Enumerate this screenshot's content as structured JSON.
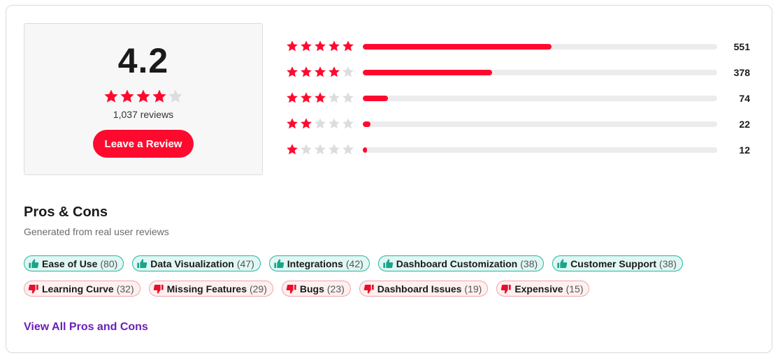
{
  "colors": {
    "accent": "#ff0a2f",
    "star_empty": "#dddddd",
    "pro_icon": "#1aa58b",
    "con_icon": "#e8102b",
    "link": "#6a1fb8"
  },
  "summary": {
    "rating": "4.2",
    "rating_value": 4.2,
    "stars_filled": 4,
    "review_count": "1,037 reviews",
    "leave_review_label": "Leave a Review"
  },
  "distribution": [
    {
      "stars": 5,
      "count": "551",
      "fraction": 0.532
    },
    {
      "stars": 4,
      "count": "378",
      "fraction": 0.365
    },
    {
      "stars": 3,
      "count": "74",
      "fraction": 0.071
    },
    {
      "stars": 2,
      "count": "22",
      "fraction": 0.021
    },
    {
      "stars": 1,
      "count": "12",
      "fraction": 0.012
    }
  ],
  "pros_cons": {
    "title": "Pros & Cons",
    "subtitle": "Generated from real user reviews",
    "pros": [
      {
        "label": "Ease of Use",
        "count": "(80)",
        "icon": "thumbs-up-icon"
      },
      {
        "label": "Data Visualization",
        "count": "(47)",
        "icon": "thumbs-up-icon"
      },
      {
        "label": "Integrations",
        "count": "(42)",
        "icon": "thumbs-up-icon"
      },
      {
        "label": "Dashboard Customization",
        "count": "(38)",
        "icon": "thumbs-up-icon"
      },
      {
        "label": "Customer Support",
        "count": "(38)",
        "icon": "thumbs-up-icon"
      }
    ],
    "cons": [
      {
        "label": "Learning Curve",
        "count": "(32)",
        "icon": "thumbs-down-icon"
      },
      {
        "label": "Missing Features",
        "count": "(29)",
        "icon": "thumbs-down-icon"
      },
      {
        "label": "Bugs",
        "count": "(23)",
        "icon": "thumbs-down-icon"
      },
      {
        "label": "Dashboard Issues",
        "count": "(19)",
        "icon": "thumbs-down-icon"
      },
      {
        "label": "Expensive",
        "count": "(15)",
        "icon": "thumbs-down-icon"
      }
    ],
    "view_all_label": "View All Pros and Cons"
  }
}
